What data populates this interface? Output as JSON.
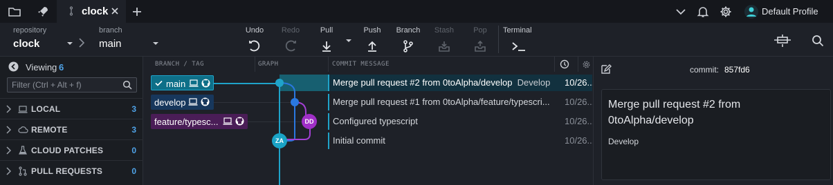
{
  "titlebar": {
    "tab_name": "clock",
    "profile_name": "Default Profile",
    "icons": [
      "folder-icon",
      "rocket-icon",
      "branch-icon",
      "close-icon",
      "plus-icon",
      "chevron-down-icon",
      "bell-icon",
      "gear-icon",
      "profile-avatar-icon"
    ]
  },
  "toolbar": {
    "repository_label": "repository",
    "repository_value": "clock",
    "branch_label": "branch",
    "branch_value": "main",
    "actions": [
      {
        "label": "Undo",
        "icon": "undo-icon",
        "enabled": true
      },
      {
        "label": "Redo",
        "icon": "redo-icon",
        "enabled": false
      },
      {
        "label": "Pull",
        "icon": "pull-icon",
        "enabled": true
      },
      {
        "label": "Push",
        "icon": "push-icon",
        "enabled": true
      },
      {
        "label": "Branch",
        "icon": "branch-icon",
        "enabled": true
      },
      {
        "label": "Stash",
        "icon": "stash-icon",
        "enabled": false
      },
      {
        "label": "Pop",
        "icon": "pop-icon",
        "enabled": false
      }
    ],
    "terminal_label": "Terminal"
  },
  "sidebar": {
    "viewing_label": "Viewing",
    "viewing_count": "6",
    "filter_placeholder": "Filter (Ctrl + Alt + f)",
    "sections": [
      {
        "name": "LOCAL",
        "count": "3",
        "icon": "laptop-icon"
      },
      {
        "name": "REMOTE",
        "count": "3",
        "icon": "cloud-icon"
      },
      {
        "name": "CLOUD PATCHES",
        "count": "0",
        "icon": "flask-icon"
      },
      {
        "name": "PULL REQUESTS",
        "count": "0",
        "icon": "pull-request-icon"
      }
    ]
  },
  "graph": {
    "headers": {
      "branch_tag": "BRANCH / TAG",
      "graph": "GRAPH",
      "commit_message": "COMMIT MESSAGE"
    },
    "branches": [
      {
        "name": "main",
        "checked": true,
        "color": "#1fa3c9"
      },
      {
        "name": "develop",
        "checked": false,
        "color": "#2a78e0"
      },
      {
        "name": "feature/typesc...",
        "checked": false,
        "color": "#a33fd4"
      }
    ],
    "avatars": [
      {
        "initials": "ZA",
        "color": "#1aa3c6"
      },
      {
        "initials": "DD",
        "color": "#a02fc7"
      }
    ],
    "commits": [
      {
        "message": "Merge pull request #2 from 0toAlpha/develop",
        "tag": "Develop",
        "date": "10/26...",
        "selected": true
      },
      {
        "message": "Merge pull request #1 from 0toAlpha/feature/typescri...",
        "tag": "",
        "date": "10/26...",
        "selected": false
      },
      {
        "message": "Configured typescript",
        "tag": "",
        "date": "10/26...",
        "selected": false
      },
      {
        "message": "Initial commit",
        "tag": "",
        "date": "10/26...",
        "selected": false
      }
    ]
  },
  "detail": {
    "commit_label": "commit:",
    "commit_sha": "857fd6",
    "title": "Merge pull request #2 from 0toAlpha/develop",
    "body": "Develop"
  }
}
